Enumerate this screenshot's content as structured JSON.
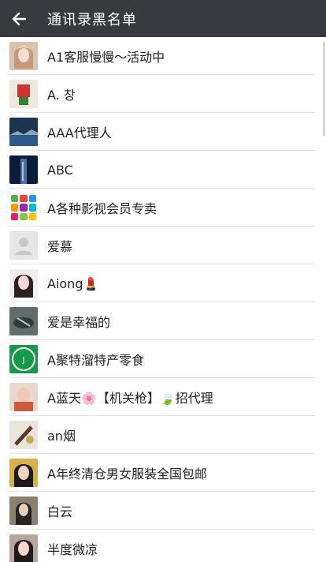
{
  "header": {
    "title": "通讯录黑名单",
    "back_icon": "arrow-left-icon"
  },
  "colors": {
    "header_bg": "#393a3f",
    "list_bg": "#ffffff",
    "divider": "#e6e6e6"
  },
  "contacts": [
    {
      "name": "A1客服慢慢～活动中"
    },
    {
      "name": "A.    창"
    },
    {
      "name": "AAA代理人"
    },
    {
      "name": "ABC"
    },
    {
      "name": "A各种影视会员专卖"
    },
    {
      "name": "爱慕"
    },
    {
      "name": "Aiong💄"
    },
    {
      "name": "爱是幸福的"
    },
    {
      "name": "A聚特溜特产零食"
    },
    {
      "name": "A蓝天🌸【机关枪】🍃招代理"
    },
    {
      "name": "an烟"
    },
    {
      "name": "A年终清仓男女服装全国包邮"
    },
    {
      "name": "白云"
    },
    {
      "name": "半度微凉"
    }
  ]
}
